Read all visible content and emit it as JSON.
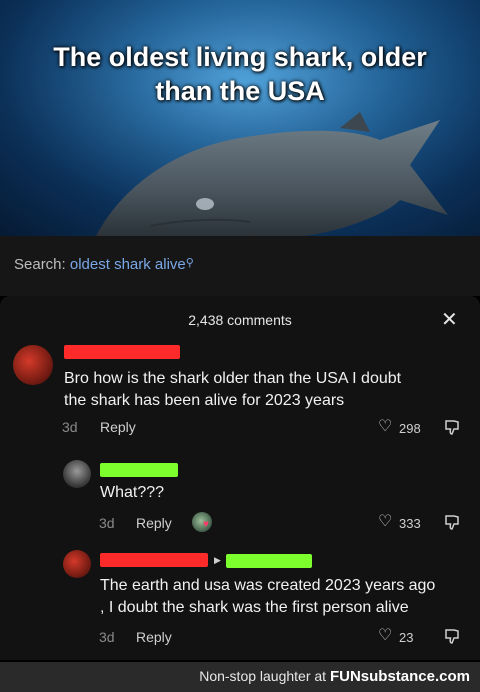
{
  "hero": {
    "title": "The oldest living shark, older than the USA"
  },
  "search": {
    "label": "Search: ",
    "query": "oldest shark alive",
    "icon": "search-icon"
  },
  "comments_header": {
    "count": "2,438 comments",
    "close_icon": "close-icon"
  },
  "comments": [
    {
      "text_line1": "Bro how is the shark older than the USA I doubt",
      "text_line2": "the shark has been alive for 2023 years",
      "age": "3d",
      "reply": "Reply",
      "likes": "298"
    },
    {
      "text_line1": "What???",
      "age": "3d",
      "reply": "Reply",
      "likes": "333"
    },
    {
      "text_line1": "The earth and usa was created 2023 years ago",
      "text_line2": ", I doubt the shark was the first person alive",
      "age": "3d",
      "reply": "Reply",
      "likes": "23"
    }
  ],
  "colors": {
    "redaction_red": "#ff2a2a",
    "redaction_green": "#7dff2e"
  },
  "footer": {
    "text": "Non-stop laughter at ",
    "brand": "FUNsubstance.com"
  }
}
